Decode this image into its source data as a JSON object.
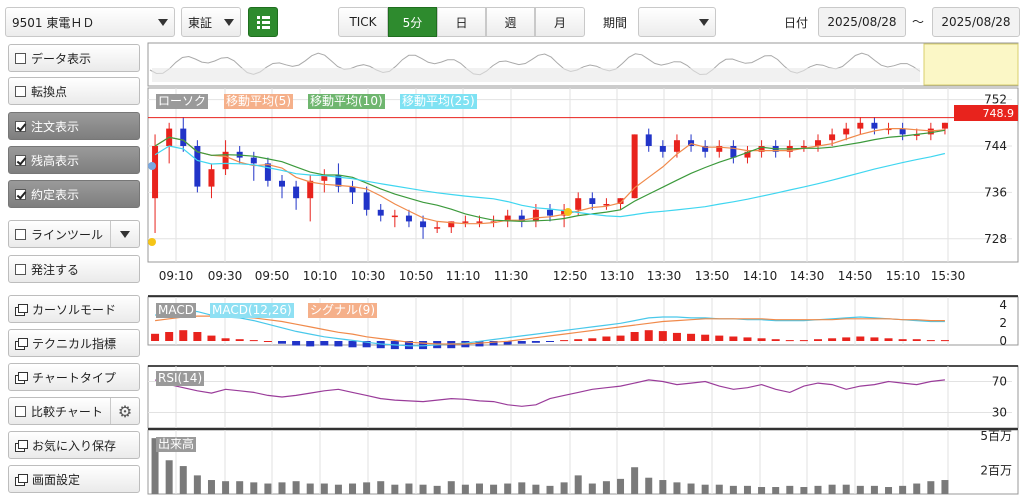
{
  "toolbar": {
    "symbol": "9501 東電ＨＤ",
    "market": "東証",
    "intervals": [
      "TICK",
      "5分",
      "日",
      "週",
      "月"
    ],
    "active_interval": "5分",
    "period_label": "期間",
    "period_value": "",
    "date_label": "日付",
    "date_from": "2025/08/28",
    "date_sep": "～",
    "date_to": "2025/08/28"
  },
  "sidebar": {
    "items": [
      {
        "label": "データ表示",
        "kind": "checkbox",
        "checked": false
      },
      {
        "label": "転換点",
        "kind": "checkbox",
        "checked": false
      },
      {
        "label": "注文表示",
        "kind": "checkbox",
        "checked": true
      },
      {
        "label": "残高表示",
        "kind": "checkbox",
        "checked": true
      },
      {
        "label": "約定表示",
        "kind": "checkbox",
        "checked": true
      },
      {
        "label": "ラインツール",
        "kind": "checkbox-dropdown",
        "checked": false
      },
      {
        "label": "発注する",
        "kind": "checkbox",
        "checked": false
      },
      {
        "label": "カーソルモード",
        "kind": "window"
      },
      {
        "label": "テクニカル指標",
        "kind": "window"
      },
      {
        "label": "チャートタイプ",
        "kind": "window"
      },
      {
        "label": "比較チャート",
        "kind": "checkbox-gear",
        "checked": false
      },
      {
        "label": "お気に入り保存",
        "kind": "window"
      },
      {
        "label": "画面設定",
        "kind": "window"
      }
    ]
  },
  "colors": {
    "up": "#e8231d",
    "down": "#2134c8",
    "ma5": "#f08a4b",
    "ma10": "#3c9a3c",
    "ma25": "#3fd6f0",
    "macd": "#49c8ea",
    "signal": "#f08a4b",
    "rsi": "#9a3c9a",
    "volume": "#7a7a7a",
    "price_line": "#e8231d",
    "active_tab": "#2e8b2e"
  },
  "main_legends": [
    "ローソク",
    "移動平均(5)",
    "移動平均(10)",
    "移動平均(25)"
  ],
  "macd_legends": [
    "MACD",
    "MACD(12,26)",
    "シグナル(9)"
  ],
  "rsi_legend": "RSI(14)",
  "volume_legend": "出来高",
  "current_price": "748.9",
  "time_labels": [
    "09:10",
    "09:30",
    "09:50",
    "10:10",
    "10:30",
    "10:50",
    "11:10",
    "11:30",
    "12:50",
    "13:10",
    "13:30",
    "13:50",
    "14:10",
    "14:30",
    "14:50",
    "15:10",
    "15:30"
  ],
  "price_axis": [
    "752",
    "744",
    "736",
    "728"
  ],
  "macd_axis": [
    "4",
    "2",
    "0"
  ],
  "rsi_axis": [
    "70",
    "30"
  ],
  "volume_axis": [
    "5百万",
    "2百万"
  ],
  "chart_data": {
    "type": "candlestick",
    "ylim": [
      724,
      754
    ],
    "current_price": 748.9,
    "candles": [
      [
        735,
        746,
        729,
        744
      ],
      [
        744,
        748,
        741,
        747
      ],
      [
        747,
        749,
        743,
        744
      ],
      [
        744,
        745,
        736,
        737
      ],
      [
        737,
        741,
        735,
        740
      ],
      [
        740,
        745,
        739,
        743
      ],
      [
        743,
        744,
        741,
        742
      ],
      [
        742,
        743,
        738,
        741
      ],
      [
        741,
        742,
        737,
        738
      ],
      [
        738,
        739,
        735,
        737
      ],
      [
        737,
        738,
        733,
        735
      ],
      [
        735,
        739,
        731,
        738
      ],
      [
        738,
        740,
        736,
        739
      ],
      [
        739,
        741,
        736,
        737
      ],
      [
        737,
        738,
        734,
        736
      ],
      [
        736,
        737,
        732,
        733
      ],
      [
        733,
        734,
        731,
        732
      ],
      [
        732,
        733,
        730,
        732
      ],
      [
        732,
        733,
        730,
        731
      ],
      [
        731,
        732,
        728,
        730
      ],
      [
        730,
        731,
        729,
        730
      ],
      [
        730,
        731,
        729,
        731
      ],
      [
        731,
        732,
        730,
        731
      ],
      [
        731,
        732,
        730,
        731
      ],
      [
        731,
        732,
        730,
        731
      ],
      [
        731,
        733,
        730,
        732
      ],
      [
        732,
        733,
        730,
        731
      ],
      [
        731,
        734,
        730,
        733
      ],
      [
        733,
        734,
        731,
        732
      ],
      [
        732,
        734,
        730,
        733
      ],
      [
        733,
        736,
        732,
        735
      ],
      [
        735,
        736,
        733,
        734
      ],
      [
        734,
        735,
        733,
        734
      ],
      [
        734,
        735,
        733,
        735
      ],
      [
        735,
        746,
        735,
        746
      ],
      [
        746,
        747,
        743,
        744
      ],
      [
        744,
        745,
        742,
        743
      ],
      [
        743,
        746,
        742,
        745
      ],
      [
        745,
        746,
        743,
        744
      ],
      [
        744,
        745,
        742,
        743
      ],
      [
        743,
        745,
        742,
        744
      ],
      [
        744,
        745,
        741,
        742
      ],
      [
        742,
        744,
        741,
        743
      ],
      [
        743,
        745,
        742,
        744
      ],
      [
        744,
        745,
        742,
        743
      ],
      [
        743,
        745,
        742,
        744
      ],
      [
        744,
        745,
        743,
        744
      ],
      [
        744,
        746,
        743,
        745
      ],
      [
        745,
        747,
        744,
        746
      ],
      [
        746,
        748,
        745,
        747
      ],
      [
        747,
        749,
        746,
        748
      ],
      [
        748,
        749,
        746,
        747
      ],
      [
        747,
        748,
        746,
        747
      ],
      [
        747,
        748,
        745,
        746
      ],
      [
        746,
        747,
        745,
        746
      ],
      [
        746,
        748,
        745,
        747
      ],
      [
        747,
        748,
        746,
        748
      ]
    ],
    "macd_hist": [
      0.8,
      1.0,
      1.2,
      1.0,
      0.6,
      0.3,
      0.2,
      0.1,
      0,
      -0.3,
      -0.5,
      -0.6,
      -0.5,
      -0.6,
      -0.7,
      -0.7,
      -0.8,
      -0.9,
      -0.9,
      -0.9,
      -0.8,
      -0.8,
      -0.7,
      -0.6,
      -0.5,
      -0.4,
      -0.3,
      -0.2,
      -0.1,
      0.1,
      0.2,
      0.3,
      0.5,
      0.6,
      1.0,
      1.2,
      1.1,
      0.9,
      0.8,
      0.7,
      0.6,
      0.5,
      0.4,
      0.3,
      0.2,
      0.1,
      0.1,
      0.2,
      0.3,
      0.4,
      0.5,
      0.4,
      0.3,
      0.2,
      0.2,
      0.1,
      0.1
    ],
    "macd": [
      2.2,
      2.6,
      2.8,
      2.6,
      2.2,
      2.0,
      1.9,
      1.6,
      1.2,
      0.8,
      0.4,
      0.1,
      -0.2,
      -0.4,
      -0.6,
      -0.8,
      -1.0,
      -1.1,
      -1.2,
      -1.2,
      -1.1,
      -1.0,
      -0.9,
      -0.7,
      -0.5,
      -0.3,
      -0.1,
      0.1,
      0.3,
      0.5,
      0.7,
      0.9,
      1.1,
      1.3,
      1.6,
      1.9,
      2.0,
      2.0,
      1.9,
      1.9,
      1.8,
      1.8,
      1.7,
      1.7,
      1.6,
      1.6,
      1.6,
      1.7,
      1.8,
      1.9,
      2.0,
      1.9,
      1.8,
      1.7,
      1.6,
      1.5,
      1.5
    ],
    "signal": [
      1.6,
      1.8,
      2.0,
      2.1,
      2.1,
      2.1,
      2.0,
      1.9,
      1.7,
      1.5,
      1.2,
      0.9,
      0.6,
      0.3,
      0.1,
      -0.2,
      -0.4,
      -0.6,
      -0.8,
      -0.9,
      -1.0,
      -1.0,
      -1.0,
      -0.9,
      -0.8,
      -0.7,
      -0.5,
      -0.3,
      -0.1,
      0.1,
      0.3,
      0.5,
      0.7,
      0.9,
      1.1,
      1.3,
      1.5,
      1.6,
      1.7,
      1.8,
      1.8,
      1.8,
      1.8,
      1.8,
      1.7,
      1.7,
      1.7,
      1.7,
      1.7,
      1.8,
      1.8,
      1.8,
      1.8,
      1.7,
      1.7,
      1.6,
      1.6
    ],
    "rsi": [
      72,
      66,
      62,
      58,
      55,
      60,
      58,
      56,
      52,
      50,
      52,
      55,
      58,
      60,
      56,
      52,
      48,
      46,
      45,
      44,
      46,
      48,
      47,
      45,
      44,
      40,
      38,
      40,
      48,
      52,
      56,
      60,
      62,
      64,
      68,
      72,
      70,
      66,
      68,
      70,
      64,
      60,
      62,
      66,
      60,
      56,
      64,
      68,
      66,
      60,
      64,
      66,
      70,
      68,
      66,
      70,
      72
    ],
    "volume": [
      4.8,
      2.9,
      2.4,
      1.6,
      1.2,
      1.1,
      1.1,
      1.0,
      0.9,
      1.0,
      1.1,
      0.9,
      0.9,
      0.8,
      0.9,
      1.0,
      1.1,
      0.8,
      0.9,
      0.8,
      0.7,
      1.1,
      0.8,
      0.9,
      0.8,
      0.9,
      1.0,
      0.8,
      0.7,
      1.0,
      1.6,
      0.9,
      1.1,
      1.3,
      2.3,
      1.4,
      1.2,
      1.0,
      0.9,
      0.8,
      0.8,
      0.7,
      0.7,
      0.6,
      0.6,
      0.7,
      0.6,
      0.7,
      0.8,
      0.8,
      0.7,
      0.7,
      0.6,
      0.7,
      0.9,
      1.1,
      1.2
    ],
    "volume_max": 5.5
  }
}
